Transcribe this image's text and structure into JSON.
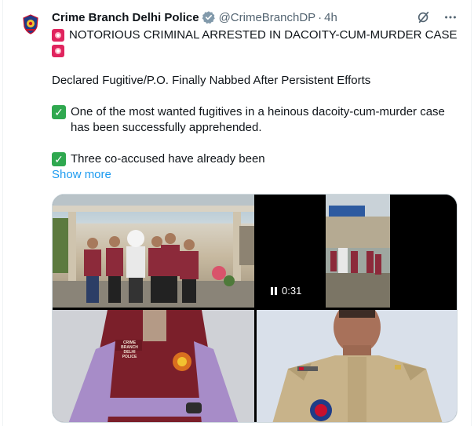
{
  "tweet": {
    "author": {
      "name": "Crime Branch Delhi Police",
      "handle": "@CrimeBranchDP",
      "time": "4h",
      "separator": "·"
    },
    "headline": "NOTORIOUS CRIMINAL ARRESTED IN DACOITY-CUM-MURDER CASE",
    "subheadline": "Declared Fugitive/P.O. Finally Nabbed After Persistent Efforts",
    "point1": "One of the most wanted fugitives in a heinous dacoity-cum-murder case has been successfully apprehended.",
    "point2": "Three co-accused have already been",
    "show_more": "Show more",
    "media": {
      "video_duration": "0:31",
      "photo1_text": "CRIME BRANCH DELHI POLICE",
      "photo3_text": "CRIME BRANCH DELHI POLICE"
    }
  },
  "icons": {
    "verified": "verified-badge-icon",
    "grok": "grok-icon",
    "more": "more-options-icon",
    "siren": "rotating-light-emoji",
    "check": "check-mark-emoji",
    "pause": "pause-icon"
  },
  "colors": {
    "link": "#1d9bf0",
    "verified": "#829aab",
    "text_secondary": "#536471",
    "siren": "#e0245e",
    "check": "#2fa84f"
  }
}
